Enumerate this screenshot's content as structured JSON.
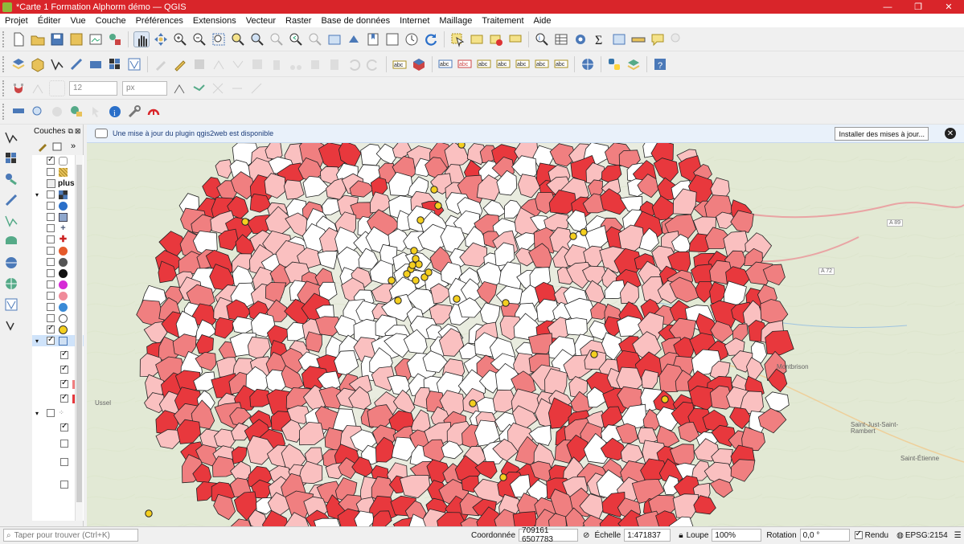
{
  "window": {
    "title": "*Carte 1 Formation Alphorm démo — QGIS",
    "controls": [
      "—",
      "❐",
      "✕"
    ]
  },
  "menu": [
    "Projet",
    "Éditer",
    "Vue",
    "Couche",
    "Préférences",
    "Extensions",
    "Vecteur",
    "Raster",
    "Base de données",
    "Internet",
    "Maillage",
    "Traitement",
    "Aide"
  ],
  "snapping": {
    "tolerance": "12",
    "unit": "px"
  },
  "layers_panel": {
    "title": "Couches",
    "label_plus": "plus"
  },
  "message_bar": {
    "text": "Une mise à jour du plugin qgis2web est disponible",
    "button": "Installer des mises à jour..."
  },
  "map_places": [
    "Ussel",
    "Montbrison",
    "Saint-Just-Saint-Rambert",
    "Saint-Étienne",
    "A 89",
    "A 72"
  ],
  "status": {
    "search_placeholder": "Taper pour trouver (Ctrl+K)",
    "coord_label": "Coordonnée",
    "coord_value": "709161  6507783",
    "scale_label": "Échelle",
    "scale_value": "1:471837",
    "magnifier_label": "Loupe",
    "magnifier_value": "100%",
    "rotation_label": "Rotation",
    "rotation_value": "0,0 °",
    "render_label": "Rendu",
    "crs": "EPSG:2154"
  },
  "colors": {
    "title_bar": "#d9252a",
    "choro_dark": "#e8383d",
    "choro_mid": "#f07f80",
    "choro_light": "#fac0c0",
    "point_fill": "#f4cf1f"
  }
}
